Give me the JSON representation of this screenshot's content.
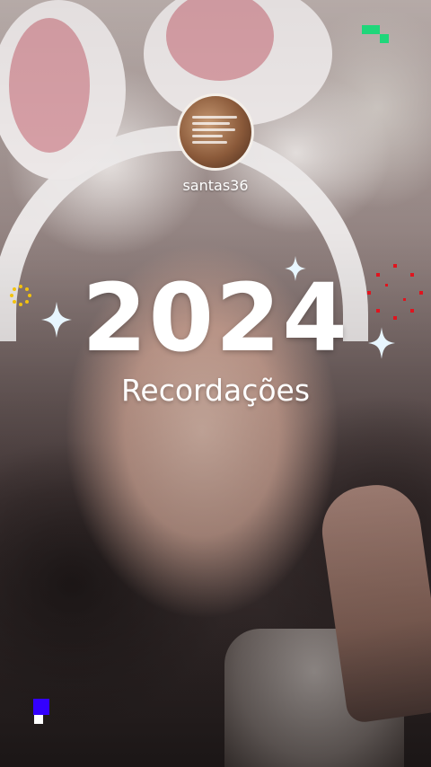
{
  "profile": {
    "username": "santas36"
  },
  "title": {
    "year": "2024",
    "subtitle": "Recordações"
  },
  "colors": {
    "text": "#ffffff",
    "sparkle": "#e8f6ff",
    "fireworks_red": "#e0141e",
    "fireworks_yellow": "#f3c20e",
    "green_accent": "#1fd67a",
    "blue_accent": "#3300ff"
  },
  "icons": [
    "sparkle-icon",
    "fireworks-icon"
  ]
}
